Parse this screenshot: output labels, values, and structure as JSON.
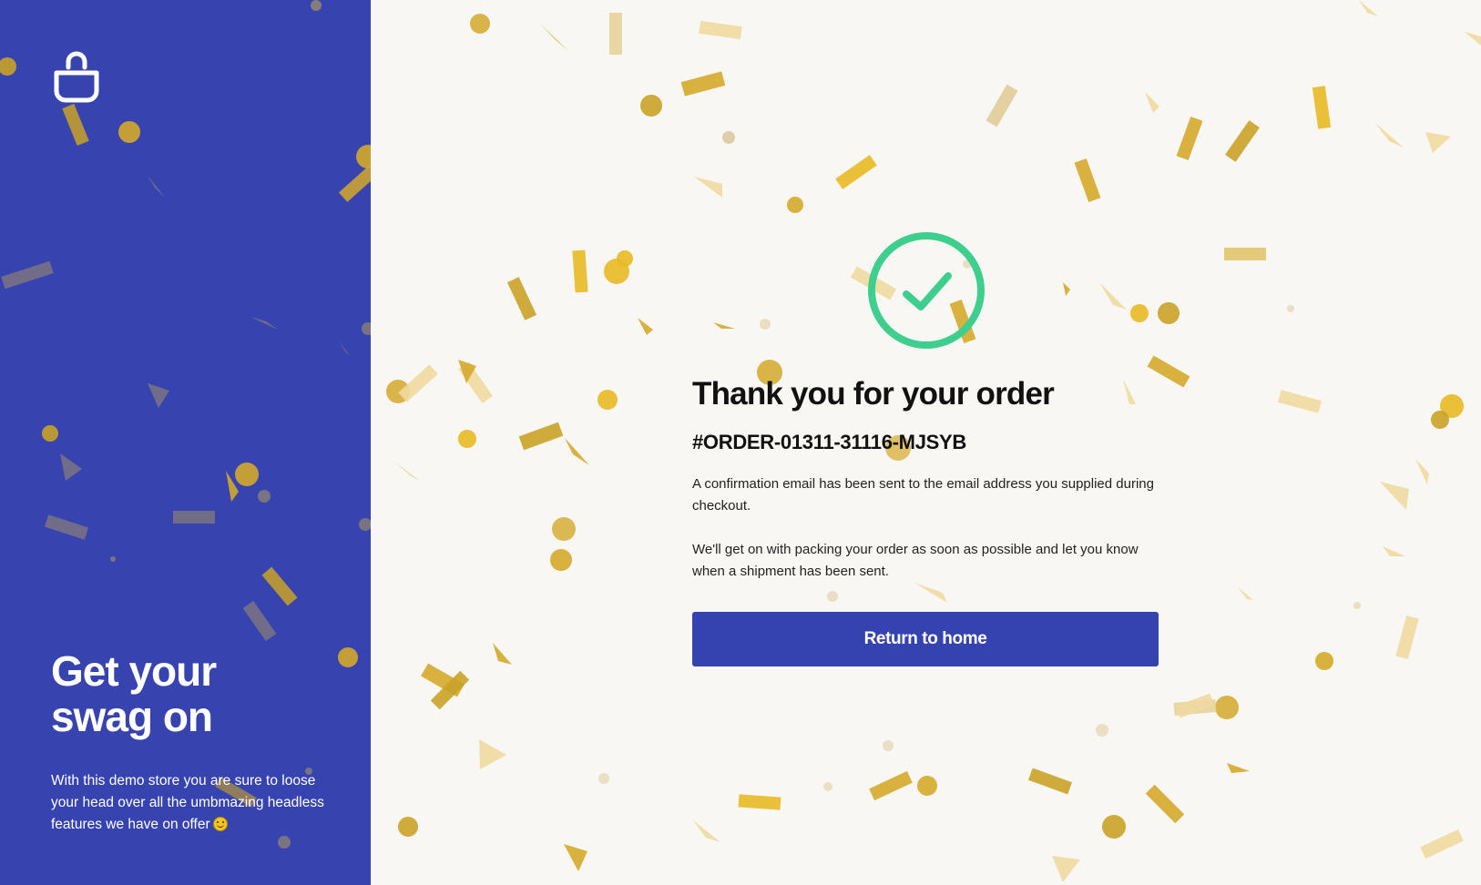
{
  "colors": {
    "sidebar": "#3744b0",
    "background": "#f8f7f4",
    "button": "#3543b0",
    "success": "#3ecf8e",
    "confetti": [
      "#c9a227",
      "#e8b923",
      "#eed9a0"
    ]
  },
  "sidebar": {
    "logo_icon": "shopping-bag-icon",
    "heading_line1": "Get your",
    "heading_line2": "swag on",
    "description": "With this demo store you are sure to loose your head over all the umbmazing headless features we have on offer",
    "emoji_icon": "smiley-icon"
  },
  "confirmation": {
    "status_icon": "check-circle-icon",
    "title": "Thank you for your order",
    "order_number": "#ORDER-01311-31116-MJSYB",
    "email_message": "A confirmation email has been sent to the email address you supplied during checkout.",
    "shipping_message": "We'll get on with packing your order as soon as possible and let you know when a shipment has been sent.",
    "return_button_label": "Return to home"
  }
}
